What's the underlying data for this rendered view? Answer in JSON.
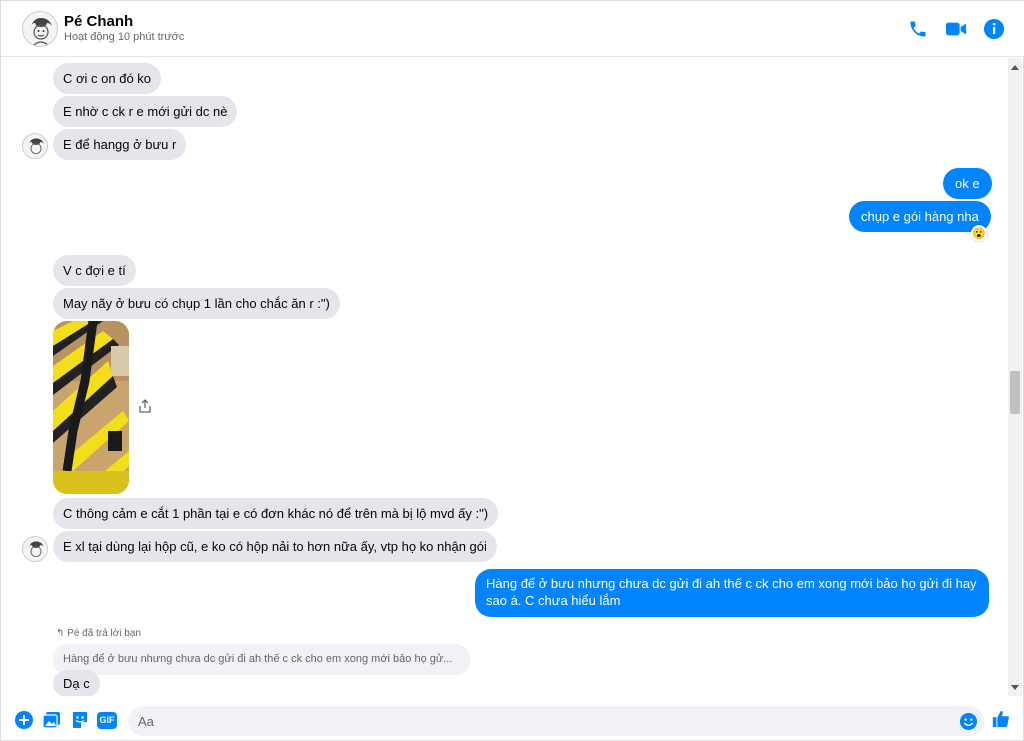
{
  "header": {
    "contact_name": "Pé Chanh",
    "status": "Hoạt động 10 phút trước",
    "icons": [
      "phone-icon",
      "video-icon",
      "info-icon"
    ]
  },
  "messages": [
    {
      "side": "in",
      "text": "C ơi c on đó ko"
    },
    {
      "side": "in",
      "text": "E nhờ c ck r e mới gửi dc nè"
    },
    {
      "side": "in",
      "text": "E để hangg ở bưu r"
    },
    {
      "side": "out",
      "text": "ok e"
    },
    {
      "side": "out",
      "text": "chụp e gói hàng nha",
      "reaction": "😮"
    },
    {
      "side": "in",
      "text": "V c đợi e tí"
    },
    {
      "side": "in",
      "text": "May nãy ở bưu có chụp 1 lần cho chắc ăn r :\")"
    },
    {
      "side": "in",
      "type": "photo"
    },
    {
      "side": "in",
      "text": "C thông cảm e cắt 1 phần tại e có đơn khác nó để trên mà bị lộ mvd ấy :\")"
    },
    {
      "side": "in",
      "text": "E xl tại dùng lại hộp cũ, e ko có hộp nải to hơn nữa ấy, vtp họ ko nhận gói"
    },
    {
      "side": "out",
      "text_line1": "Hàng để ở bưu nhưng chưa dc gửi đi ah thế c ck cho em xong mới bảo họ gửi đi hay",
      "text_line2": "sao á. C chưa hiểu lắm"
    },
    {
      "side": "in",
      "reply_label": "Pé đã trả lời bạn",
      "reply_quote": "Hàng để ở bưu nhưng chưa dc gửi đi ah thế c ck cho em xong mới bảo họ gử...",
      "text": "Dạ c"
    }
  ],
  "composer": {
    "placeholder": "Aa",
    "icons": [
      "plus-icon",
      "photo-icon",
      "sticker-icon",
      "gif-icon",
      "emoji-icon",
      "thumbs-up-icon"
    ],
    "gif_label": "GIF"
  },
  "colors": {
    "accent": "#0084ff",
    "incoming_bubble": "#e4e6eb",
    "muted_text": "#65676b"
  }
}
